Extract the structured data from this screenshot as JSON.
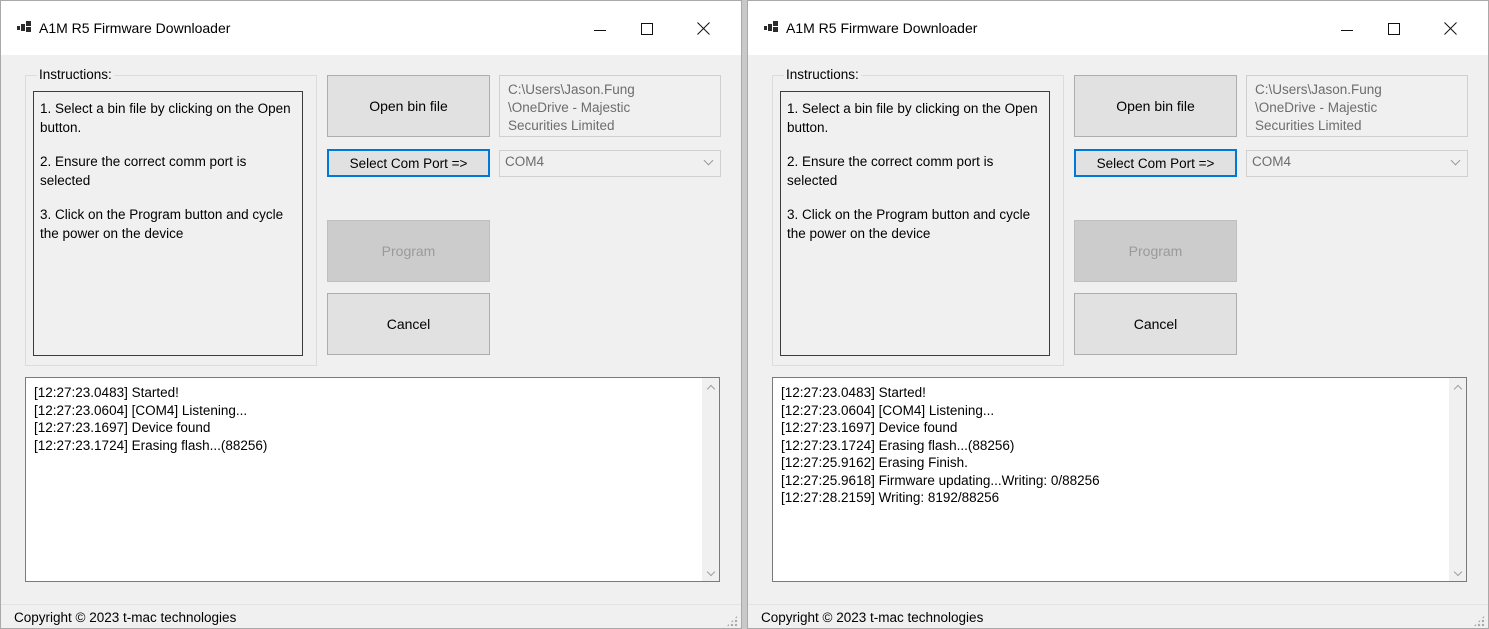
{
  "windows": [
    {
      "title": "A1M R5 Firmware Downloader",
      "instructions_legend": "Instructions:",
      "instructions": [
        "1. Select a bin file by clicking on the Open button.",
        "2. Ensure the correct comm port is selected",
        "3. Click on the Program button and cycle the power on the device"
      ],
      "open_button": "Open bin file",
      "file_path_lines": [
        "C:\\Users\\Jason.Fung",
        "\\OneDrive - Majestic",
        "Securities Limited"
      ],
      "select_com_button": "Select Com Port =>",
      "com_port": "COM4",
      "program_button": "Program",
      "cancel_button": "Cancel",
      "log": [
        "[12:27:23.0483] Started!",
        "[12:27:23.0604] [COM4] Listening...",
        "[12:27:23.1697] Device found",
        "[12:27:23.1724] Erasing flash...(88256)",
        "",
        "",
        ""
      ],
      "status": "Copyright © 2023 t-mac technologies"
    },
    {
      "title": "A1M R5 Firmware Downloader",
      "instructions_legend": "Instructions:",
      "instructions": [
        "1. Select a bin file by clicking on the Open button.",
        "2. Ensure the correct comm port is selected",
        "3. Click on the Program button and cycle the power on the device"
      ],
      "open_button": "Open bin file",
      "file_path_lines": [
        "C:\\Users\\Jason.Fung",
        "\\OneDrive - Majestic",
        "Securities Limited"
      ],
      "select_com_button": "Select Com Port =>",
      "com_port": "COM4",
      "program_button": "Program",
      "cancel_button": "Cancel",
      "log": [
        "[12:27:23.0483] Started!",
        "[12:27:23.0604] [COM4] Listening...",
        "[12:27:23.1697] Device found",
        "[12:27:23.1724] Erasing flash...(88256)",
        "[12:27:25.9162] Erasing Finish.",
        "[12:27:25.9618] Firmware updating...Writing: 0/88256",
        "[12:27:28.2159] Writing: 8192/88256"
      ],
      "status": "Copyright © 2023 t-mac technologies"
    }
  ],
  "colors": {
    "focus_border": "#0078d7",
    "window_bg": "#f0f0f0",
    "disabled_text": "#9a9a9a"
  },
  "icons": [
    "app-icon",
    "minimize-icon",
    "maximize-icon",
    "close-icon",
    "dropdown-arrow-icon",
    "scroll-up-icon",
    "scroll-down-icon",
    "resize-grip-icon"
  ]
}
